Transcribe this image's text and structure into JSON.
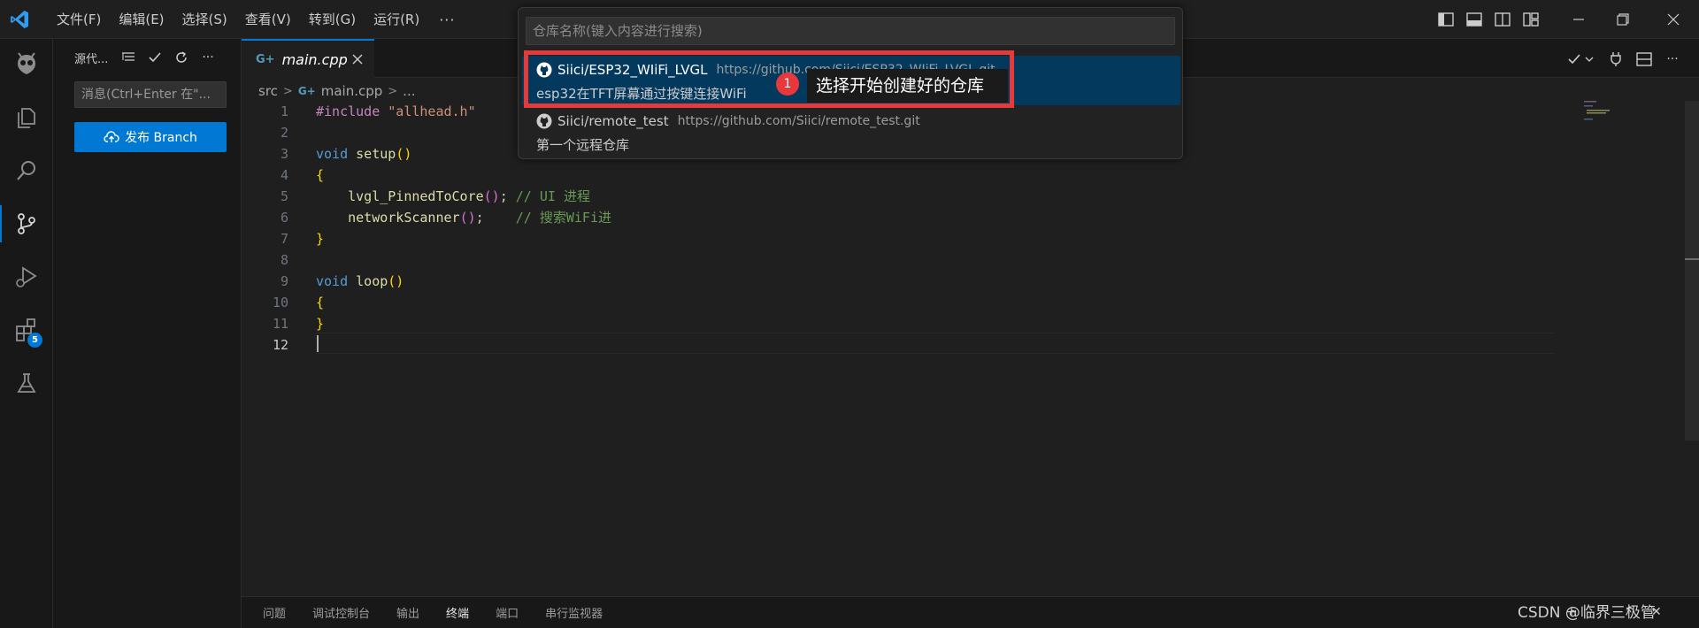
{
  "menu": {
    "items": [
      "文件(F)",
      "编辑(E)",
      "选择(S)",
      "查看(V)",
      "转到(G)",
      "运行(R)"
    ],
    "more": "···"
  },
  "activity_bar": {
    "items": [
      "platformio-icon",
      "explorer-icon",
      "search-icon",
      "source-control-icon",
      "run-debug-icon",
      "extensions-icon",
      "testing-icon"
    ],
    "extensions_badge": "5"
  },
  "sidebar": {
    "title": "源代...",
    "commit_placeholder": "消息(Ctrl+Enter 在\"...",
    "publish_label": "发布 Branch"
  },
  "editor": {
    "tab_label": "main.cpp",
    "breadcrumb": {
      "folder": "src",
      "file": "main.cpp",
      "more": "..."
    },
    "line_numbers": [
      "1",
      "2",
      "3",
      "4",
      "5",
      "6",
      "7",
      "8",
      "9",
      "10",
      "11",
      "12"
    ],
    "code": {
      "l1_directive": "#include",
      "l1_string": "\"allhead.h\"",
      "l3_type": "void",
      "l3_name": "setup",
      "paren_pair": "()",
      "open_brace": "{",
      "close_brace": "}",
      "l5_call": "lvgl_PinnedToCore",
      "l5_semi": ";",
      "l5_comment": "// UI 进程",
      "l6_call": "networkScanner",
      "l6_semi": ";",
      "l6_comment": "// 搜索WiFi进",
      "l9_type": "void",
      "l9_name": "loop"
    }
  },
  "quick_pick": {
    "placeholder": "仓库名称(键入内容进行搜索)",
    "items": [
      {
        "label": "Siici/ESP32_WIiFi_LVGL",
        "description": "https://github.com/Siici/ESP32_WIiFi_LVGL.git",
        "detail": "esp32在TFT屏幕通过按键连接WiFi"
      },
      {
        "label": "Siici/remote_test",
        "description": "https://github.com/Siici/remote_test.git",
        "detail": "第一个远程仓库"
      }
    ]
  },
  "annotation": {
    "number": "1",
    "text": "选择开始创建好的仓库"
  },
  "panel": {
    "tabs": [
      "问题",
      "调试控制台",
      "输出",
      "终端",
      "端口",
      "串行监视器"
    ],
    "active": "终端"
  },
  "watermark": "CSDN @临界三极管",
  "colors": {
    "accent": "#0078d4",
    "annotation_red": "#e43a3a",
    "selection": "#04395e"
  }
}
